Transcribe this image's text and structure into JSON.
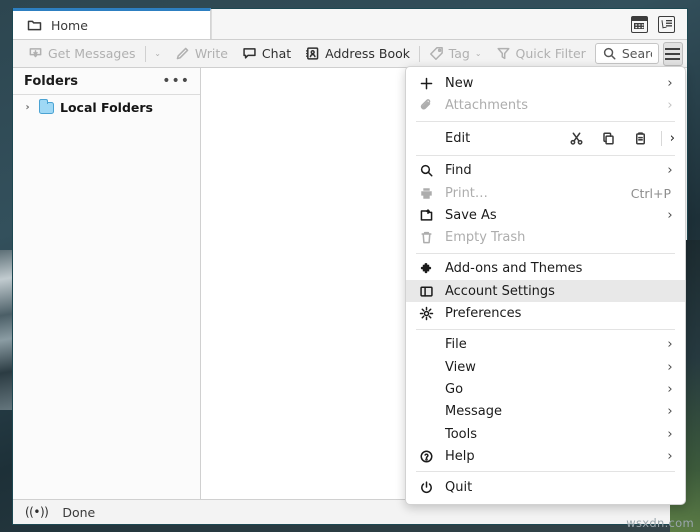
{
  "window": {
    "tabs": [
      {
        "label": "Home",
        "icon": "folder-icon",
        "active": true
      }
    ],
    "tab_icons": [
      {
        "name": "calendar-icon"
      },
      {
        "name": "tasks-icon"
      }
    ]
  },
  "toolbar": {
    "get_messages": "Get Messages",
    "get_messages_caret": "⌄",
    "write": "Write",
    "chat": "Chat",
    "address_book": "Address Book",
    "tag": "Tag",
    "tag_caret": "⌄",
    "quick_filter": "Quick Filter",
    "search_value": "Search <(",
    "search_icon": "search-icon",
    "hamburger": "app-menu-icon"
  },
  "sidebar": {
    "title": "Folders",
    "more_label": "•••",
    "folders": [
      {
        "label": "Local Folders",
        "twisty": "›",
        "icon": "folder-icon"
      }
    ]
  },
  "statusbar": {
    "connection_icon": "signal-icon",
    "connection_glyph": "((•))",
    "text": "Done"
  },
  "appmenu": {
    "groups": [
      {
        "items": [
          {
            "label": "New",
            "icon": "plus-icon",
            "chevron": "›",
            "disabled": false
          },
          {
            "label": "Attachments",
            "icon": "paperclip-icon",
            "chevron": "›",
            "disabled": true
          }
        ]
      },
      {
        "edit_row": {
          "label": "Edit",
          "actions": [
            {
              "name": "cut-icon"
            },
            {
              "name": "copy-icon"
            },
            {
              "name": "paste-icon"
            }
          ],
          "chevron": "›"
        }
      },
      {
        "items": [
          {
            "label": "Find",
            "icon": "search-icon",
            "chevron": "›",
            "disabled": false
          },
          {
            "label": "Print…",
            "icon": "printer-icon",
            "accel": "Ctrl+P",
            "disabled": true
          },
          {
            "label": "Save As",
            "icon": "save-as-icon",
            "chevron": "›",
            "disabled": false
          },
          {
            "label": "Empty Trash",
            "icon": "trash-icon",
            "disabled": true
          }
        ]
      },
      {
        "items": [
          {
            "label": "Add-ons and Themes",
            "icon": "puzzle-icon",
            "disabled": false
          },
          {
            "label": "Account Settings",
            "icon": "account-settings-icon",
            "disabled": false,
            "highlighted": true
          },
          {
            "label": "Preferences",
            "icon": "gear-icon",
            "disabled": false
          }
        ]
      },
      {
        "items": [
          {
            "label": "File",
            "chevron": "›",
            "disabled": false
          },
          {
            "label": "View",
            "chevron": "›",
            "disabled": false
          },
          {
            "label": "Go",
            "chevron": "›",
            "disabled": false
          },
          {
            "label": "Message",
            "chevron": "›",
            "disabled": false
          },
          {
            "label": "Tools",
            "chevron": "›",
            "disabled": false
          },
          {
            "label": "Help",
            "icon": "help-icon",
            "chevron": "›",
            "disabled": false
          }
        ]
      },
      {
        "items": [
          {
            "label": "Quit",
            "icon": "power-icon",
            "disabled": false
          }
        ]
      }
    ]
  },
  "watermark": "wsxdn.com"
}
